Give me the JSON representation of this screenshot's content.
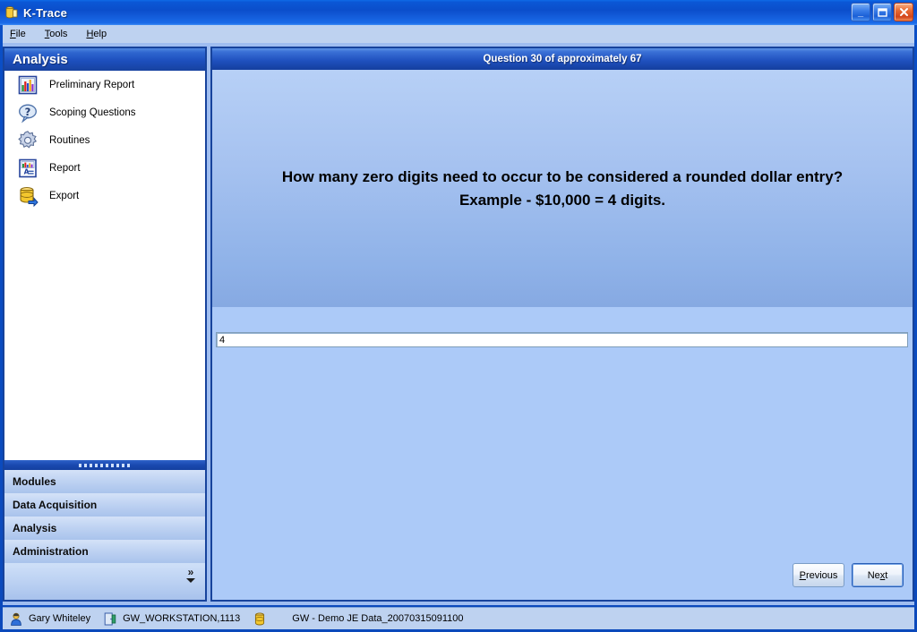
{
  "window": {
    "title": "K-Trace",
    "app_icon": "app-cylinder-icon",
    "controls": {
      "minimize": "minimize-button",
      "maximize": "maximize-button",
      "close": "close-button"
    }
  },
  "menubar": {
    "items": [
      {
        "label": "File",
        "accel": "F"
      },
      {
        "label": "Tools",
        "accel": "T"
      },
      {
        "label": "Help",
        "accel": "H"
      }
    ]
  },
  "sidebar": {
    "header": "Analysis",
    "items": [
      {
        "label": "Preliminary Report",
        "icon": "bar-chart-icon"
      },
      {
        "label": "Scoping Questions",
        "icon": "question-bubble-icon"
      },
      {
        "label": "Routines",
        "icon": "gear-icon"
      },
      {
        "label": "Report",
        "icon": "report-chart-icon"
      },
      {
        "label": "Export",
        "icon": "database-export-icon"
      }
    ],
    "groups": [
      {
        "label": "Modules"
      },
      {
        "label": "Data Acquisition"
      },
      {
        "label": "Analysis"
      },
      {
        "label": "Administration"
      }
    ],
    "expander": "»"
  },
  "main": {
    "header": "Question 30 of approximately 67",
    "question_line1": "How many zero digits need to occur to be considered a rounded dollar entry?",
    "question_line2": "Example - $10,000 = 4 digits.",
    "answer_value": "4",
    "answer_placeholder": "",
    "buttons": {
      "previous": {
        "label": "Previous",
        "accel": "P"
      },
      "next": {
        "label": "Next",
        "accel": "x"
      }
    }
  },
  "statusbar": {
    "user": "Gary Whiteley",
    "workstation": "GW_WORKSTATION,1113",
    "dataset": "GW - Demo JE Data_20070315091100",
    "icons": {
      "user": "user-icon",
      "workstation": "workstation-door-icon",
      "dataset": "database-cylinder-icon"
    }
  },
  "colors": {
    "titlebar_blue": "#0b4ecb",
    "accent_blue": "#17439c",
    "panel_blue": "#accaf8",
    "close_red": "#d2451a"
  }
}
